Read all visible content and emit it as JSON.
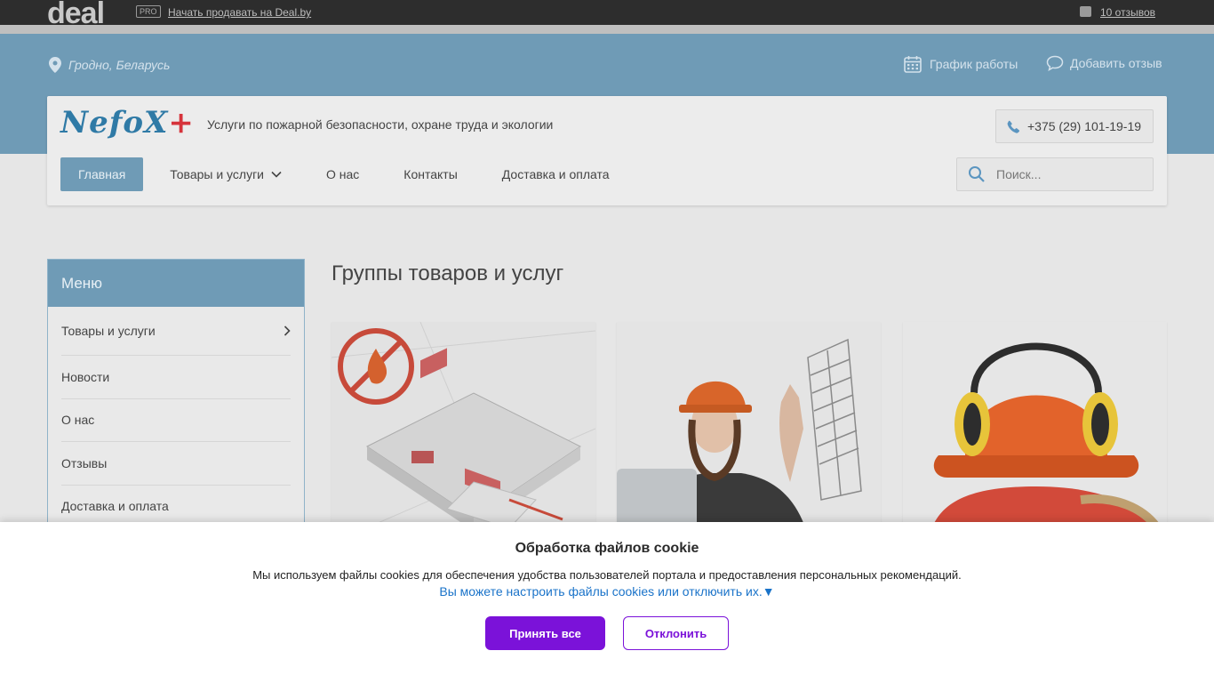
{
  "topbar": {
    "logo": "deal",
    "pro_badge": "PRO",
    "sell_link": "Начать продавать на Deal.by",
    "reviews_link": "10 отзывов"
  },
  "location": "Гродно, Беларусь",
  "header_links": {
    "schedule": "График работы",
    "add_review": "Добавить отзыв"
  },
  "company": {
    "name": "NefoX",
    "name_suffix": "+",
    "tagline": "Услуги по пожарной безопасности, охране труда и экологии",
    "phone": "+375 (29) 101-19-19"
  },
  "nav": {
    "items": [
      "Главная",
      "Товары и услуги",
      "О нас",
      "Контакты",
      "Доставка и оплата"
    ]
  },
  "search": {
    "placeholder": "Поиск..."
  },
  "sidebar": {
    "title": "Меню",
    "items": [
      "Товары и услуги",
      "Новости",
      "О нас",
      "Отзывы",
      "Доставка и оплата"
    ]
  },
  "main": {
    "title": "Группы товаров и услуг"
  },
  "cookie": {
    "title": "Обработка файлов cookie",
    "text": "Мы используем файлы cookies для обеспечения удобства пользователей портала и предоставления персональных рекомендаций.",
    "link": "Вы можете настроить файлы cookies или отключить их.▼",
    "accept": "Принять все",
    "reject": "Отклонить"
  },
  "colors": {
    "accent": "#6f9bb6",
    "cookie_button": "#7b12d9",
    "link": "#1a73c9"
  }
}
